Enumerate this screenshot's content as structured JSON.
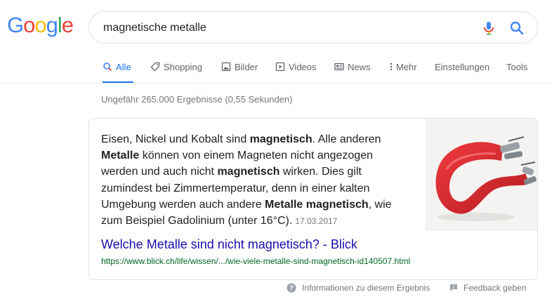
{
  "logo": {
    "text": "Google",
    "letters": [
      "G",
      "o",
      "o",
      "g",
      "l",
      "e"
    ],
    "colors": [
      "#4285F4",
      "#EA4335",
      "#FBBC05",
      "#4285F4",
      "#34A853",
      "#EA4335"
    ]
  },
  "search": {
    "query": "magnetische metalle"
  },
  "tabs": [
    {
      "label": "Alle",
      "icon": "search-icon",
      "active": true
    },
    {
      "label": "Shopping",
      "icon": "tag-icon"
    },
    {
      "label": "Bilder",
      "icon": "image-icon"
    },
    {
      "label": "Videos",
      "icon": "play-icon"
    },
    {
      "label": "News",
      "icon": "newspaper-icon"
    },
    {
      "label": "Mehr",
      "icon": "more-vert-icon"
    },
    {
      "label": "Einstellungen"
    },
    {
      "label": "Tools"
    }
  ],
  "stats": "Ungefähr 265.000 Ergebnisse (0,55 Sekunden)",
  "snippet": {
    "parts": [
      {
        "t": "Eisen, Nickel und Kobalt sind ",
        "b": false
      },
      {
        "t": "magnetisch",
        "b": true
      },
      {
        "t": ". Alle anderen ",
        "b": false
      },
      {
        "t": "Metalle",
        "b": true
      },
      {
        "t": " können von einem Magneten nicht angezogen werden und auch nicht ",
        "b": false
      },
      {
        "t": "magnetisch",
        "b": true
      },
      {
        "t": " wirken. Dies gilt zumindest bei Zimmertemperatur, denn in einer kalten Umgebung werden auch andere ",
        "b": false
      },
      {
        "t": "Metalle magnetisch",
        "b": true
      },
      {
        "t": ", wie zum Beispiel Gadolinium (unter 16°C).",
        "b": false
      }
    ],
    "date": "17.03.2017"
  },
  "result": {
    "title": "Welche Metalle sind nicht magnetisch? - Blick",
    "url": "https://www.blick.ch/life/wissen/.../wie-viele-metalle-sind-magnetisch-id140507.html"
  },
  "footer": {
    "info": "Informationen zu diesem Ergebnis",
    "feedback": "Feedback geben"
  },
  "colors": {
    "link": "#1a0dab",
    "url": "#006621",
    "active_tab": "#1a73e8",
    "magnet": "#d8262b"
  }
}
